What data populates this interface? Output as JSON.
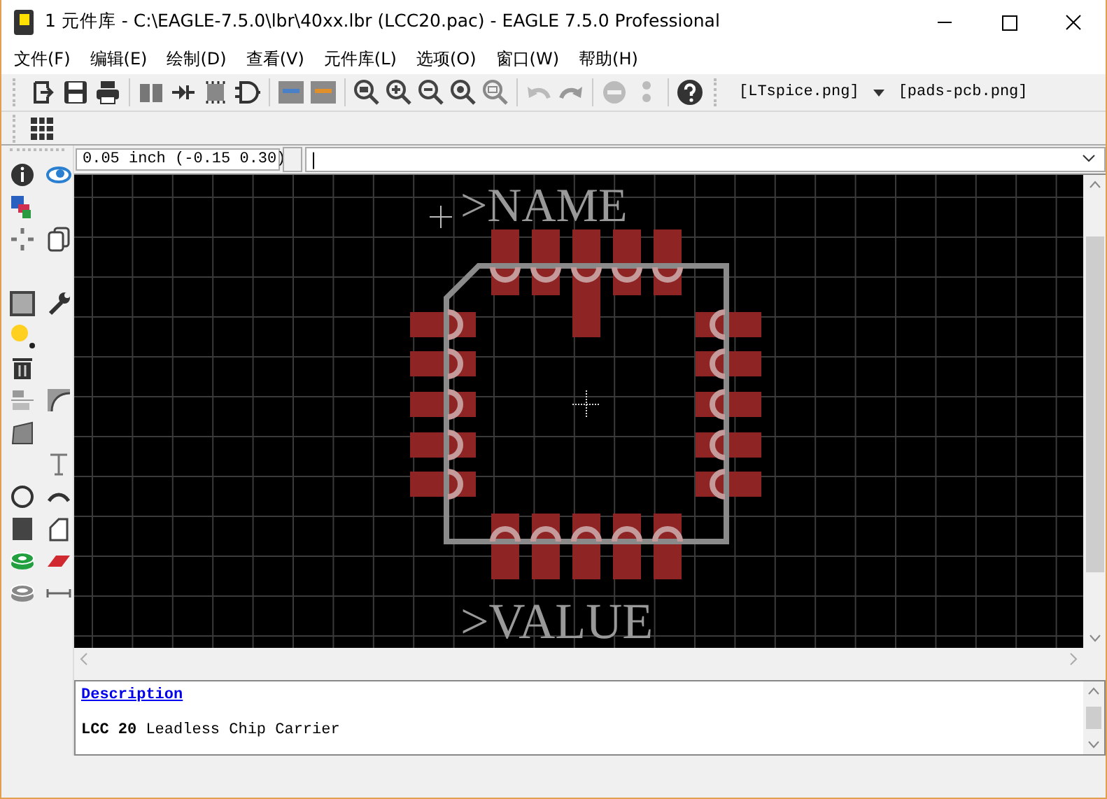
{
  "window": {
    "title": "1 元件库 - C:\\EAGLE-7.5.0\\lbr\\40xx.lbr (LCC20.pac) - EAGLE 7.5.0 Professional"
  },
  "menu": [
    "文件(F)",
    "编辑(E)",
    "绘制(D)",
    "查看(V)",
    "元件库(L)",
    "选项(O)",
    "窗口(W)",
    "帮助(H)"
  ],
  "script_buttons": [
    "[LTspice.png]",
    "[pads-pcb.png]"
  ],
  "command_bar": {
    "grid_info": "0.05 inch (-0.15 0.30)",
    "value": "|"
  },
  "canvas": {
    "name_label": ">NAME",
    "value_label": ">VALUE"
  },
  "description": {
    "link": "Description",
    "text": "**LCC 20** Leadless Chip Carrier"
  }
}
